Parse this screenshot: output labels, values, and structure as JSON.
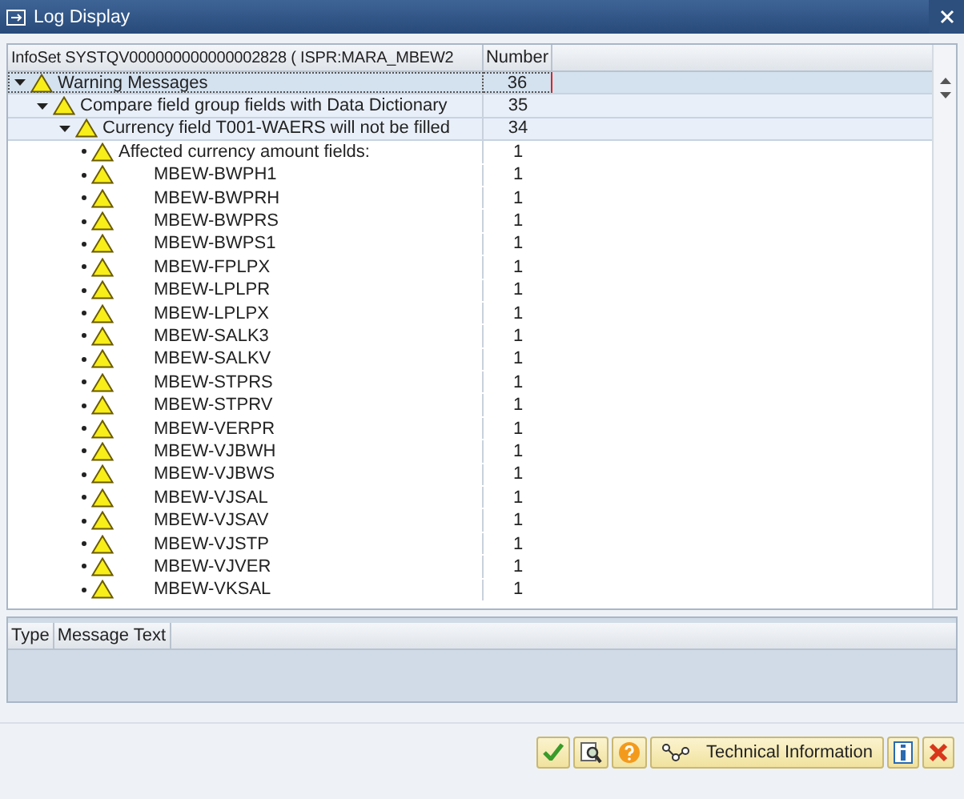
{
  "window": {
    "title": "Log Display"
  },
  "tree": {
    "columns": [
      "InfoSet SYSTQV000000000000002828 ( ISPR:MARA_MBEW2",
      "Number"
    ],
    "rows": [
      {
        "text": "Warning Messages",
        "number": "36",
        "selected": true,
        "expanded": true,
        "children": [
          {
            "text": "Compare field group fields with Data Dictionary",
            "number": "35",
            "selected": false,
            "expanded": true,
            "children": [
              {
                "text": "Currency field T001-WAERS will not be filled",
                "number": "34",
                "selected": false,
                "expanded": true,
                "children": [
                  {
                    "kind": "group",
                    "text": "Affected currency amount fields:",
                    "number": "1",
                    "selected": false
                  },
                  {
                    "kind": "entry",
                    "text": "MBEW-BWPH1",
                    "number": "1",
                    "selected": false
                  },
                  {
                    "kind": "entry",
                    "text": "MBEW-BWPRH",
                    "number": "1",
                    "selected": false
                  },
                  {
                    "kind": "entry",
                    "text": "MBEW-BWPRS",
                    "number": "1",
                    "selected": false
                  },
                  {
                    "kind": "entry",
                    "text": "MBEW-BWPS1",
                    "number": "1",
                    "selected": false
                  },
                  {
                    "kind": "entry",
                    "text": "MBEW-FPLPX",
                    "number": "1",
                    "selected": false
                  },
                  {
                    "kind": "entry",
                    "text": "MBEW-LPLPR",
                    "number": "1",
                    "selected": false
                  },
                  {
                    "kind": "entry",
                    "text": "MBEW-LPLPX",
                    "number": "1",
                    "selected": false
                  },
                  {
                    "kind": "entry",
                    "text": "MBEW-SALK3",
                    "number": "1",
                    "selected": false
                  },
                  {
                    "kind": "entry",
                    "text": "MBEW-SALKV",
                    "number": "1",
                    "selected": false
                  },
                  {
                    "kind": "entry",
                    "text": "MBEW-STPRS",
                    "number": "1",
                    "selected": false
                  },
                  {
                    "kind": "entry",
                    "text": "MBEW-STPRV",
                    "number": "1",
                    "selected": false
                  },
                  {
                    "kind": "entry",
                    "text": "MBEW-VERPR",
                    "number": "1",
                    "selected": false
                  },
                  {
                    "kind": "entry",
                    "text": "MBEW-VJBWH",
                    "number": "1",
                    "selected": false
                  },
                  {
                    "kind": "entry",
                    "text": "MBEW-VJBWS",
                    "number": "1",
                    "selected": false
                  },
                  {
                    "kind": "entry",
                    "text": "MBEW-VJSAL",
                    "number": "1",
                    "selected": false
                  },
                  {
                    "kind": "entry",
                    "text": "MBEW-VJSAV",
                    "number": "1",
                    "selected": false
                  },
                  {
                    "kind": "entry",
                    "text": "MBEW-VJSTP",
                    "number": "1",
                    "selected": false
                  },
                  {
                    "kind": "entry",
                    "text": "MBEW-VJVER",
                    "number": "1",
                    "selected": false
                  },
                  {
                    "kind": "entry",
                    "text": "MBEW-VKSAL",
                    "number": "1",
                    "selected": false
                  }
                ]
              }
            ]
          }
        ]
      }
    ]
  },
  "messages": {
    "columns": [
      "Type",
      "Message Text"
    ]
  },
  "buttons": [
    {
      "kind": "check"
    },
    {
      "kind": "find"
    },
    {
      "kind": "help"
    },
    {
      "kind": "technical",
      "label": "Technical Information"
    },
    {
      "kind": "info"
    },
    {
      "kind": "cancel"
    }
  ]
}
